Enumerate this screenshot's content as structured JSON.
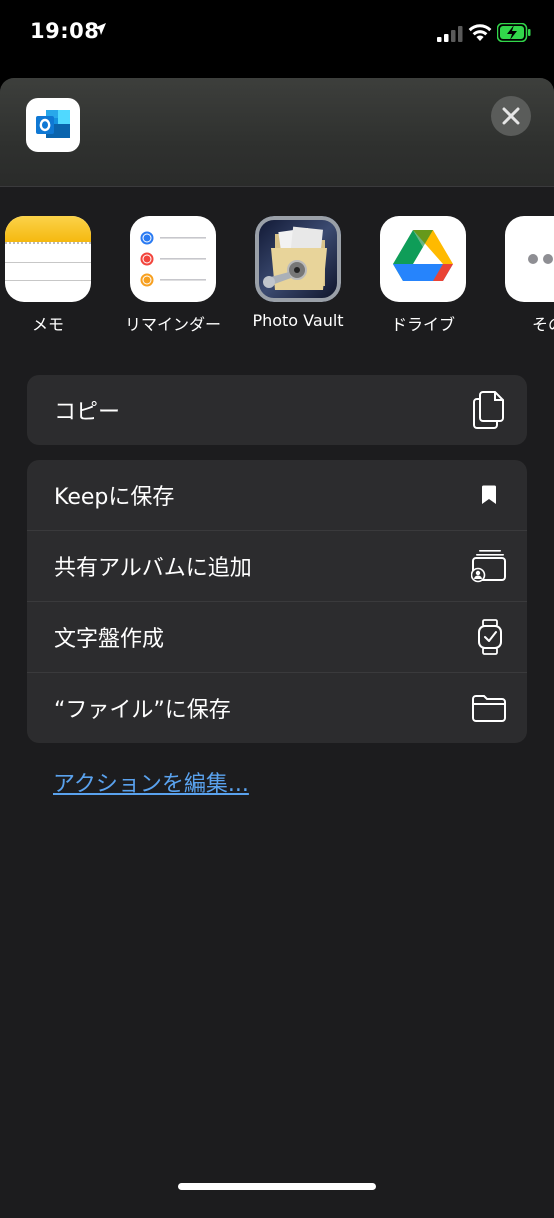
{
  "status": {
    "time": "19:08"
  },
  "sheet": {
    "apps": [
      {
        "label": "メモ",
        "icon": "notes-icon"
      },
      {
        "label": "リマインダー",
        "icon": "reminders-icon"
      },
      {
        "label": "Photo Vault",
        "icon": "photo-vault-icon"
      },
      {
        "label": "ドライブ",
        "icon": "google-drive-icon"
      },
      {
        "label": "その",
        "icon": "more-icon"
      }
    ],
    "copy": {
      "label": "コピー",
      "icon": "copy-icon"
    },
    "actions": [
      {
        "label": "Keepに保存",
        "icon": "bookmark-icon"
      },
      {
        "label": "共有アルバムに追加",
        "icon": "shared-album-icon"
      },
      {
        "label": "文字盤作成",
        "icon": "watch-icon"
      },
      {
        "label": "“ファイル”に保存",
        "icon": "folder-icon"
      }
    ],
    "edit_actions": "アクションを編集..."
  }
}
